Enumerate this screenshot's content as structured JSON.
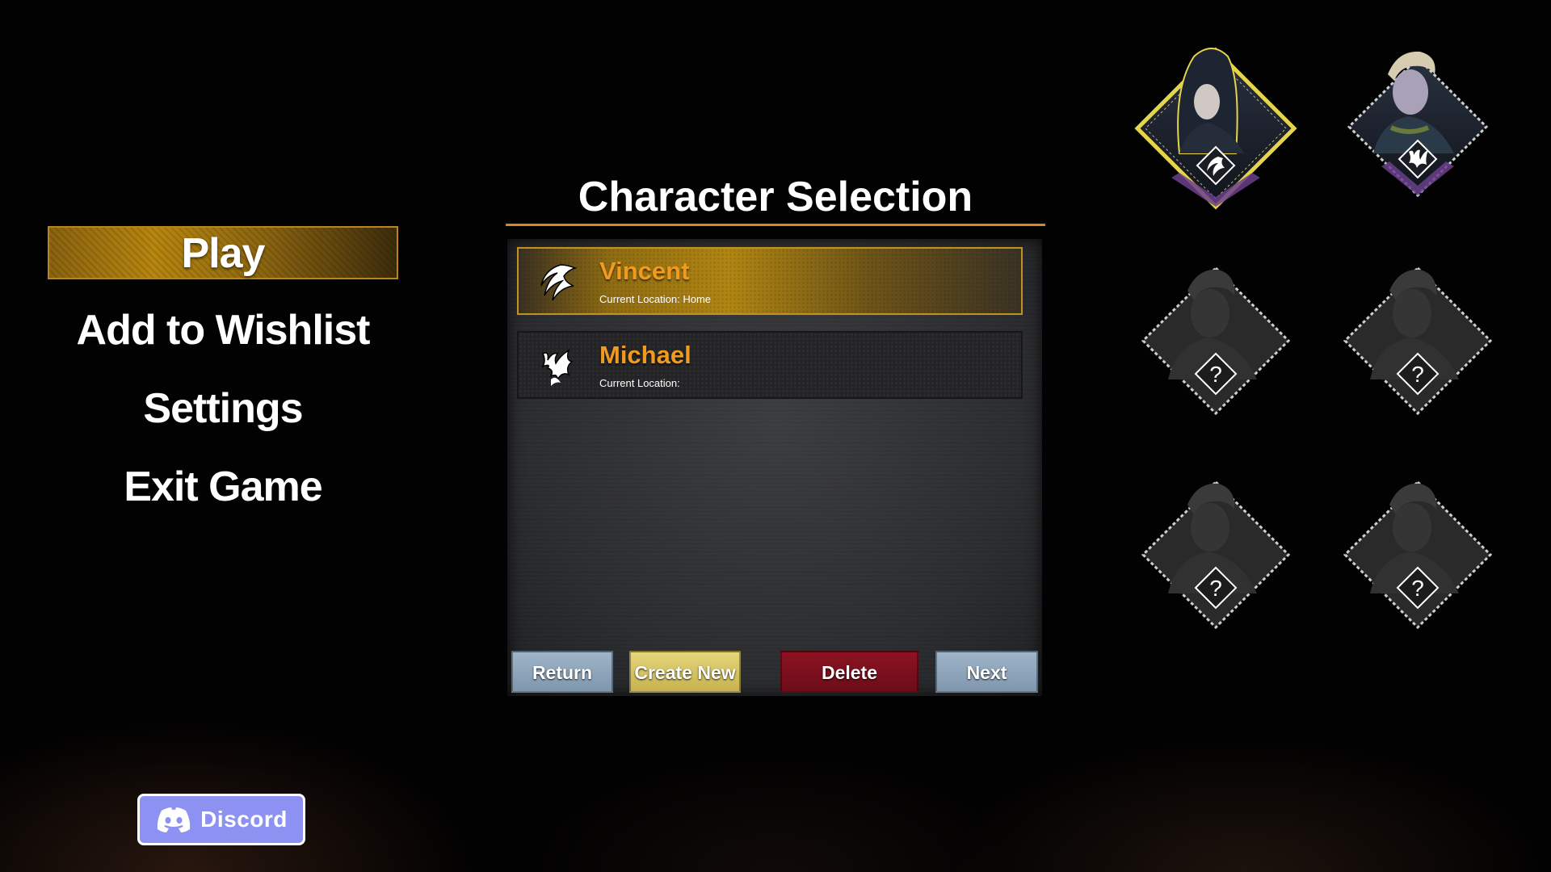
{
  "menu": {
    "play": "Play",
    "wishlist": "Add to Wishlist",
    "settings": "Settings",
    "exit": "Exit Game"
  },
  "discord": {
    "label": "Discord",
    "icon": "discord-icon",
    "color": "#8d92f2"
  },
  "panel": {
    "title": "Character Selection",
    "accent": "#d48a1e",
    "characters": [
      {
        "name": "Vincent",
        "location": "Current Location: Home",
        "icon": "claw-emblem-icon",
        "selected": true
      },
      {
        "name": "Michael",
        "location": "Current Location:",
        "icon": "flame-claw-emblem-icon",
        "selected": false
      }
    ],
    "buttons": {
      "return": "Return",
      "create_new": "Create New",
      "delete": "Delete",
      "next": "Next"
    }
  },
  "portraits": [
    {
      "slot": "hooded-character",
      "state": "selected",
      "badge_icon": "claw-emblem-icon"
    },
    {
      "slot": "blonde-character",
      "state": "available",
      "badge_icon": "flame-claw-emblem-icon"
    },
    {
      "slot": "locked-1",
      "state": "locked",
      "badge": "?"
    },
    {
      "slot": "locked-2",
      "state": "locked",
      "badge": "?"
    },
    {
      "slot": "locked-3",
      "state": "locked",
      "badge": "?"
    },
    {
      "slot": "locked-4",
      "state": "locked",
      "badge": "?"
    }
  ]
}
